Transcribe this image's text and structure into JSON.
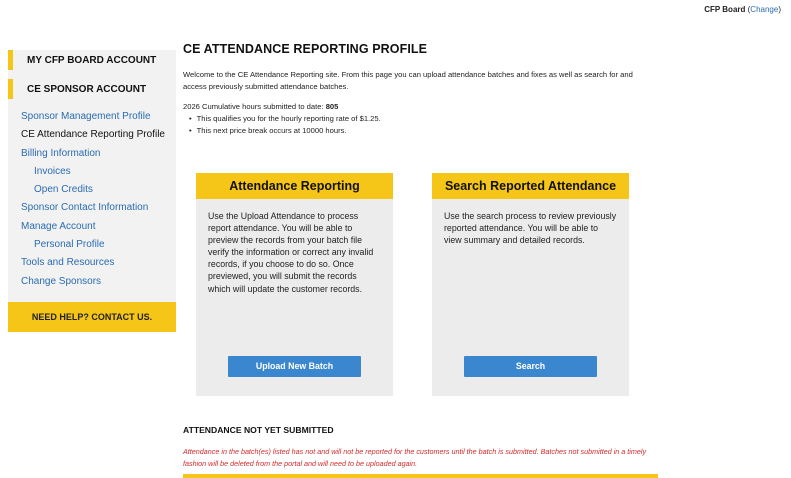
{
  "topbar": {
    "org": "CFP Board",
    "change_open": " (",
    "change": "Change",
    "change_close": ")"
  },
  "sidebar": {
    "headers": [
      "MY CFP BOARD ACCOUNT",
      "CE SPONSOR ACCOUNT"
    ],
    "items": [
      {
        "label": "Sponsor Management Profile",
        "indent": false,
        "active": false
      },
      {
        "label": "CE Attendance Reporting Profile",
        "indent": false,
        "active": true
      },
      {
        "label": "Billing Information",
        "indent": false,
        "active": false
      },
      {
        "label": "Invoices",
        "indent": true,
        "active": false
      },
      {
        "label": "Open Credits",
        "indent": true,
        "active": false
      },
      {
        "label": "Sponsor Contact Information",
        "indent": false,
        "active": false
      },
      {
        "label": "Manage Account",
        "indent": false,
        "active": false
      },
      {
        "label": "Personal Profile",
        "indent": true,
        "active": false
      },
      {
        "label": "Tools and Resources",
        "indent": false,
        "active": false
      },
      {
        "label": "Change Sponsors",
        "indent": false,
        "active": false
      }
    ],
    "help": "NEED HELP? CONTACT US."
  },
  "main": {
    "title": "CE ATTENDANCE REPORTING PROFILE",
    "intro": "Welcome to the CE Attendance Reporting site.  From this page you can upload attendance batches and fixes as well as search for and access previously submitted attendance batches.",
    "cumulative_label": "2026 Cumulative hours submitted to date: ",
    "cumulative_value": "805",
    "bullets": [
      "This qualifies you for the hourly reporting rate of $1.25.",
      "This next price break occurs at 10000 hours."
    ],
    "cards": {
      "left": {
        "title": "Attendance Reporting",
        "body": "Use the Upload Attendance to process report attendance. You will be able to preview the records from your batch file verify the information or correct any invalid records, if you choose to do so. Once previewed, you will submit the records which will update the customer records.",
        "button": "Upload New Batch"
      },
      "right": {
        "title": "Search Reported Attendance",
        "body": "Use the search process to review previously reported attendance. You will be able to view summary and detailed records.",
        "button": "Search"
      }
    }
  },
  "not_submitted": {
    "title": "ATTENDANCE NOT YET SUBMITTED",
    "warning": "Attendance in the batch(es) listed has not and will not be reported for the customers until the batch is submitted. Batches not submitted in a timely fashion will be deleted from the portal and will need to be uploaded again."
  },
  "colors": {
    "accent_yellow": "#f5c518",
    "link_blue": "#2b6cb0",
    "button_blue": "#3b87cf",
    "warning_red": "#d42b2b",
    "panel_gray": "#ececec"
  }
}
